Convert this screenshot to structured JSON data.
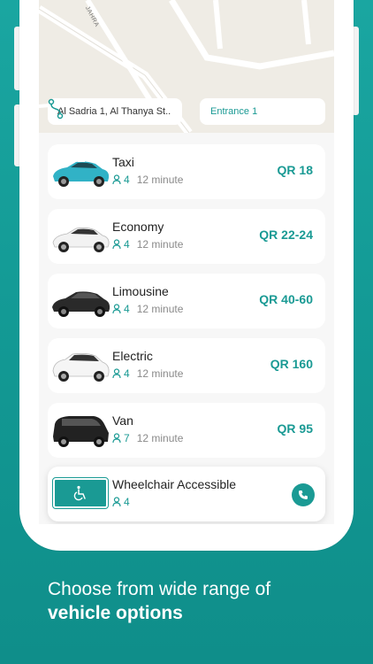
{
  "map": {
    "street_label": "JAHRA",
    "from": "Al Sadria 1, Al Thanya St..",
    "to": "Entrance 1"
  },
  "vehicles": [
    {
      "name": "Taxi",
      "seats": "4",
      "eta": "12 minute",
      "price": "QR 18",
      "icon": "taxi-car-icon",
      "color": "#31b2c6"
    },
    {
      "name": "Economy",
      "seats": "4",
      "eta": "12 minute",
      "price": "QR 22-24",
      "icon": "sedan-car-icon",
      "color": "#f2f2f2"
    },
    {
      "name": "Limousine",
      "seats": "4",
      "eta": "12 minute",
      "price": "QR 40-60",
      "icon": "limousine-car-icon",
      "color": "#2a2a2a"
    },
    {
      "name": "Electric",
      "seats": "4",
      "eta": "12 minute",
      "price": "QR 160",
      "icon": "electric-suv-icon",
      "color": "#f5f5f5"
    },
    {
      "name": "Van",
      "seats": "7",
      "eta": "12 minute",
      "price": "QR 95",
      "icon": "van-icon",
      "color": "#222222"
    }
  ],
  "wheelchair": {
    "name": "Wheelchair Accessible",
    "seats": "4",
    "icon": "wheelchair-icon",
    "action_icon": "phone-icon"
  },
  "caption": {
    "line1": "Choose from wide range of",
    "line2": "vehicle options"
  },
  "colors": {
    "accent": "#1a9a94",
    "background": "#129893"
  }
}
